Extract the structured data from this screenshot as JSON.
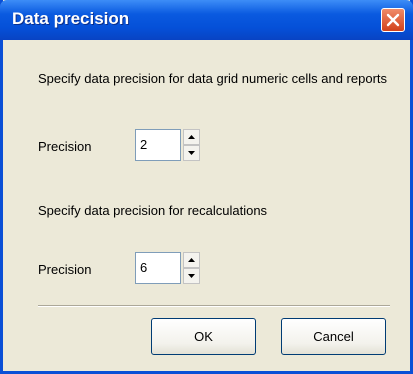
{
  "window": {
    "title": "Data precision",
    "close_icon": "close-icon"
  },
  "grid_section": {
    "description": "Specify data precision for data grid numeric cells and reports",
    "precision_label": "Precision",
    "precision_value": "2"
  },
  "recalc_section": {
    "description": "Specify data precision for recalculations",
    "precision_label": "Precision",
    "precision_value": "6"
  },
  "buttons": {
    "ok_label": "OK",
    "cancel_label": "Cancel"
  },
  "colors": {
    "titlebar": "#0550d8",
    "dialog_bg": "#ece9d8",
    "close_button": "#d2411b"
  }
}
